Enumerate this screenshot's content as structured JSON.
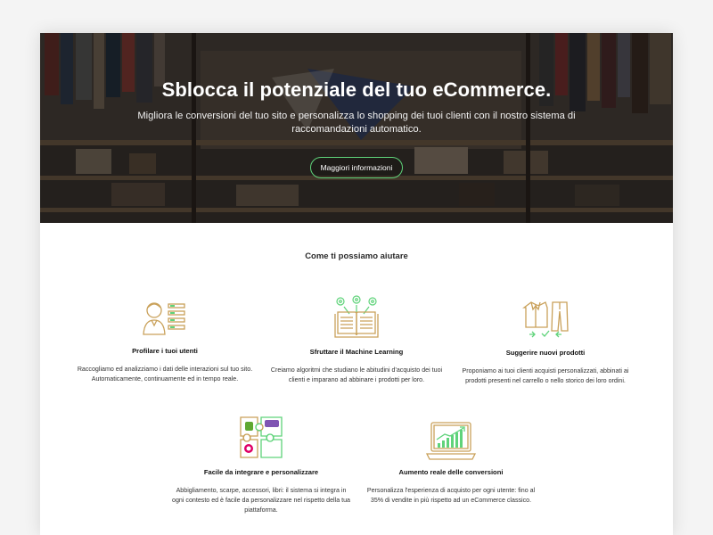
{
  "hero": {
    "title": "Sblocca il potenziale del tuo eCommerce.",
    "subtitle": "Migliora le conversioni del tuo sito e personalizza lo shopping dei tuoi clienti con il nostro sistema di raccomandazioni automatico.",
    "cta_label": "Maggiori informazioni",
    "accent_color": "#5fd37a"
  },
  "section": {
    "title": "Come ti possiamo aiutare"
  },
  "features": [
    {
      "icon": "user-profile-icon",
      "title": "Profilare i tuoi utenti",
      "description": "Raccogliamo ed analizziamo i dati delle interazioni sul tuo sito. Automaticamente, continuamente ed in tempo reale."
    },
    {
      "icon": "machine-learning-book-icon",
      "title": "Sfruttare il Machine Learning",
      "description": "Creiamo algoritmi che studiano le abitudini d'acquisto dei tuoi clienti e imparano ad abbinare i prodotti per loro."
    },
    {
      "icon": "clothing-suggestion-icon",
      "title": "Suggerire nuovi prodotti",
      "description": "Proponiamo ai tuoi clienti acquisti personalizzati, abbinati ai prodotti presenti nel carrello o nello storico dei loro ordini."
    },
    {
      "icon": "puzzle-integration-icon",
      "title": "Facile da integrare e personalizzare",
      "description": "Abbigliamento, scarpe, accessori, libri: il sistema si integra in ogni contesto ed è facile da personalizzare nel rispetto della tua piattaforma."
    },
    {
      "icon": "laptop-growth-chart-icon",
      "title": "Aumento reale delle conversioni",
      "description": "Personalizza l'esperienza di acquisto per ogni utente: fino al 35% di vendite in più rispetto ad un eCommerce classico."
    }
  ],
  "colors": {
    "icon_gold": "#c9a15a",
    "icon_green": "#5fd37a"
  }
}
